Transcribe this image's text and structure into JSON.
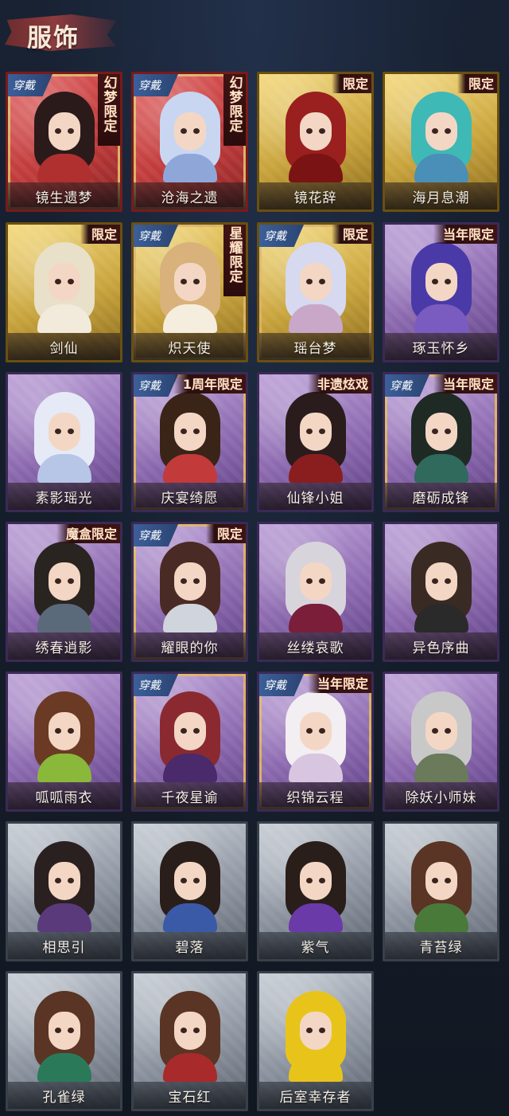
{
  "header": {
    "title": "服饰"
  },
  "badge_label": "穿戴",
  "colors": {
    "background": "#161d2a",
    "header_brush": "#a24040",
    "badge": "#3c5f9a",
    "tier_red": "#c03b3b",
    "tier_gold": "#c9a43c",
    "tier_purple": "#8d6ab0",
    "tier_grey": "#8d95a1"
  },
  "outfits": [
    {
      "name": "镜生遗梦",
      "tier": "red",
      "worn": true,
      "tag": "幻梦限定",
      "tag_style": "vertical",
      "hair": "#2a1a1a",
      "outfit": "#b03030"
    },
    {
      "name": "沧海之遗",
      "tier": "red",
      "worn": true,
      "tag": "幻梦限定",
      "tag_style": "vertical",
      "hair": "#c9d6f2",
      "outfit": "#8fa6d8"
    },
    {
      "name": "镜花辞",
      "tier": "gold",
      "worn": false,
      "tag": "限定",
      "tag_style": "horizontal",
      "hair": "#9a1f1f",
      "outfit": "#7a1414"
    },
    {
      "name": "海月息潮",
      "tier": "gold",
      "worn": false,
      "tag": "限定",
      "tag_style": "horizontal",
      "hair": "#3fb9b5",
      "outfit": "#4a8fb8"
    },
    {
      "name": "剑仙",
      "tier": "gold",
      "worn": false,
      "tag": "限定",
      "tag_style": "horizontal",
      "hair": "#e8e0c8",
      "outfit": "#f2eadb"
    },
    {
      "name": "炽天使",
      "tier": "gold",
      "worn": true,
      "tag": "星耀限定",
      "tag_style": "vertical",
      "hair": "#d8b27a",
      "outfit": "#f5eede"
    },
    {
      "name": "瑶台梦",
      "tier": "gold",
      "worn": true,
      "tag": "限定",
      "tag_style": "horizontal",
      "hair": "#d6d9ef",
      "outfit": "#c9a7c9"
    },
    {
      "name": "琢玉怀乡",
      "tier": "purple",
      "worn": false,
      "tag": "当年限定",
      "tag_style": "horizontal",
      "hair": "#4a3aa8",
      "outfit": "#7a5cc0"
    },
    {
      "name": "素影瑶光",
      "tier": "purple",
      "worn": false,
      "tag": "",
      "tag_style": "none",
      "hair": "#e6eaf6",
      "outfit": "#b7c6e6"
    },
    {
      "name": "庆宴绮愿",
      "tier": "purple",
      "worn": true,
      "tag": "1周年限定",
      "tag_style": "horizontal",
      "hair": "#3a2418",
      "outfit": "#c23a3a"
    },
    {
      "name": "仙锋小姐",
      "tier": "purple",
      "worn": false,
      "tag": "非遗炫戏",
      "tag_style": "horizontal",
      "hair": "#2a1c1c",
      "outfit": "#8a1e1e"
    },
    {
      "name": "磨砺成锋",
      "tier": "purple",
      "worn": true,
      "tag": "当年限定",
      "tag_style": "horizontal",
      "hair": "#1f2a24",
      "outfit": "#2f6a5c"
    },
    {
      "name": "绣春逍影",
      "tier": "purple",
      "worn": false,
      "tag": "魔盒限定",
      "tag_style": "horizontal",
      "hair": "#2a2420",
      "outfit": "#5a6a7a"
    },
    {
      "name": "耀眼的你",
      "tier": "purple",
      "worn": true,
      "tag": "限定",
      "tag_style": "horizontal",
      "hair": "#4a2a24",
      "outfit": "#d0d4dc"
    },
    {
      "name": "丝缕哀歌",
      "tier": "purple",
      "worn": false,
      "tag": "",
      "tag_style": "none",
      "hair": "#d8d4dc",
      "outfit": "#7a1e3a"
    },
    {
      "name": "异色序曲",
      "tier": "purple",
      "worn": false,
      "tag": "",
      "tag_style": "none",
      "hair": "#3a2a24",
      "outfit": "#2a2a2a"
    },
    {
      "name": "呱呱雨衣",
      "tier": "purple",
      "worn": false,
      "tag": "",
      "tag_style": "none",
      "hair": "#6a3a24",
      "outfit": "#8ab83a"
    },
    {
      "name": "千夜星谕",
      "tier": "purple",
      "worn": true,
      "tag": "",
      "tag_style": "none",
      "hair": "#8a2a30",
      "outfit": "#4a2a6a"
    },
    {
      "name": "织锦云程",
      "tier": "purple",
      "worn": true,
      "tag": "当年限定",
      "tag_style": "horizontal",
      "hair": "#f2eef2",
      "outfit": "#d8c6e0"
    },
    {
      "name": "除妖小师妹",
      "tier": "purple",
      "worn": false,
      "tag": "",
      "tag_style": "none",
      "hair": "#c8c8c8",
      "outfit": "#6a7a5a"
    },
    {
      "name": "相思引",
      "tier": "grey",
      "worn": false,
      "tag": "",
      "tag_style": "none",
      "hair": "#2a2020",
      "outfit": "#5a3a7a"
    },
    {
      "name": "碧落",
      "tier": "grey",
      "worn": false,
      "tag": "",
      "tag_style": "none",
      "hair": "#2a1e1a",
      "outfit": "#3a5aa8"
    },
    {
      "name": "紫气",
      "tier": "grey",
      "worn": false,
      "tag": "",
      "tag_style": "none",
      "hair": "#2a1e1a",
      "outfit": "#6a3aa8"
    },
    {
      "name": "青苔绿",
      "tier": "grey",
      "worn": false,
      "tag": "",
      "tag_style": "none",
      "hair": "#5a3424",
      "outfit": "#4a7a3a"
    },
    {
      "name": "孔雀绿",
      "tier": "grey",
      "worn": false,
      "tag": "",
      "tag_style": "none",
      "hair": "#5a3424",
      "outfit": "#2a7a5a"
    },
    {
      "name": "宝石红",
      "tier": "grey",
      "worn": false,
      "tag": "",
      "tag_style": "none",
      "hair": "#5a3424",
      "outfit": "#a82a2a"
    },
    {
      "name": "后室幸存者",
      "tier": "grey",
      "worn": false,
      "tag": "",
      "tag_style": "none",
      "hair": "#e8c41a",
      "outfit": "#e8c41a"
    }
  ]
}
